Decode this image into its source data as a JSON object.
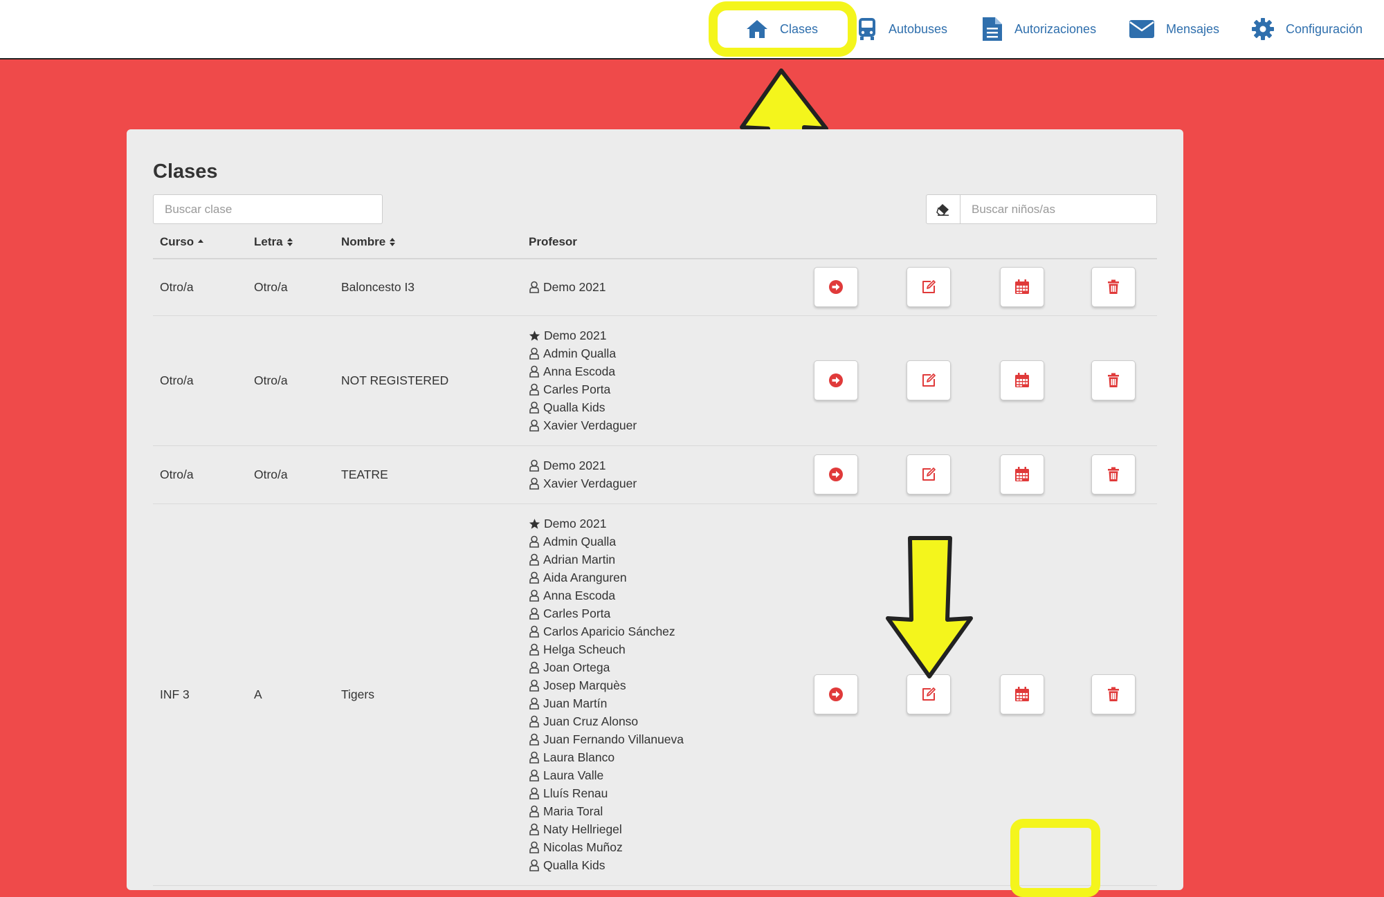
{
  "nav": {
    "items": [
      {
        "label": "Clases",
        "icon": "home-icon"
      },
      {
        "label": "Autobuses",
        "icon": "bus-icon"
      },
      {
        "label": "Autorizaciones",
        "icon": "document-icon"
      },
      {
        "label": "Mensajes",
        "icon": "envelope-icon"
      },
      {
        "label": "Configuración",
        "icon": "gear-icon"
      }
    ],
    "active": "Clases"
  },
  "page": {
    "title": "Clases",
    "search_class_placeholder": "Buscar clase",
    "search_kids_placeholder": "Buscar niños/as"
  },
  "table": {
    "headers": {
      "curso": "Curso",
      "letra": "Letra",
      "nombre": "Nombre",
      "profesor": "Profesor"
    },
    "rows": [
      {
        "curso": "Otro/a",
        "letra": "Otro/a",
        "nombre": "Baloncesto I3",
        "profesores": [
          {
            "name": "Demo 2021",
            "icon": "user-icon"
          }
        ]
      },
      {
        "curso": "Otro/a",
        "letra": "Otro/a",
        "nombre": "NOT REGISTERED",
        "profesores": [
          {
            "name": "Demo 2021",
            "icon": "star-icon"
          },
          {
            "name": "Admin Qualla",
            "icon": "user-icon"
          },
          {
            "name": "Anna Escoda",
            "icon": "user-icon"
          },
          {
            "name": "Carles Porta",
            "icon": "user-icon"
          },
          {
            "name": "Qualla Kids",
            "icon": "user-icon"
          },
          {
            "name": "Xavier Verdaguer",
            "icon": "user-icon"
          }
        ]
      },
      {
        "curso": "Otro/a",
        "letra": "Otro/a",
        "nombre": "TEATRE",
        "profesores": [
          {
            "name": "Demo 2021",
            "icon": "user-icon"
          },
          {
            "name": "Xavier Verdaguer",
            "icon": "user-icon"
          }
        ]
      },
      {
        "curso": "INF 3",
        "letra": "A",
        "nombre": "Tigers",
        "profesores": [
          {
            "name": "Demo 2021",
            "icon": "star-icon"
          },
          {
            "name": "Admin Qualla",
            "icon": "user-icon"
          },
          {
            "name": "Adrian Martin",
            "icon": "user-icon"
          },
          {
            "name": "Aida Aranguren",
            "icon": "user-icon"
          },
          {
            "name": "Anna Escoda",
            "icon": "user-icon"
          },
          {
            "name": "Carles Porta",
            "icon": "user-icon"
          },
          {
            "name": "Carlos Aparicio Sánchez",
            "icon": "user-icon"
          },
          {
            "name": "Helga Scheuch",
            "icon": "user-icon"
          },
          {
            "name": "Joan Ortega",
            "icon": "user-icon"
          },
          {
            "name": "Josep Marquès",
            "icon": "user-icon"
          },
          {
            "name": "Juan Martín",
            "icon": "user-icon"
          },
          {
            "name": "Juan Cruz Alonso",
            "icon": "user-icon"
          },
          {
            "name": "Juan Fernando Villanueva",
            "icon": "user-icon"
          },
          {
            "name": "Laura Blanco",
            "icon": "user-icon"
          },
          {
            "name": "Laura Valle",
            "icon": "user-icon"
          },
          {
            "name": "Lluís Renau",
            "icon": "user-icon"
          },
          {
            "name": "Maria Toral",
            "icon": "user-icon"
          },
          {
            "name": "Naty Hellriegel",
            "icon": "user-icon"
          },
          {
            "name": "Nicolas Muñoz",
            "icon": "user-icon"
          },
          {
            "name": "Qualla Kids",
            "icon": "user-icon"
          }
        ]
      }
    ],
    "actions": [
      "go-icon",
      "edit-icon",
      "calendar-icon",
      "trash-icon"
    ]
  },
  "colors": {
    "background": "#ef4a4a",
    "accent_blue": "#2f6fad",
    "action_red": "#e03a3a",
    "highlight_yellow": "#f4f51c"
  }
}
